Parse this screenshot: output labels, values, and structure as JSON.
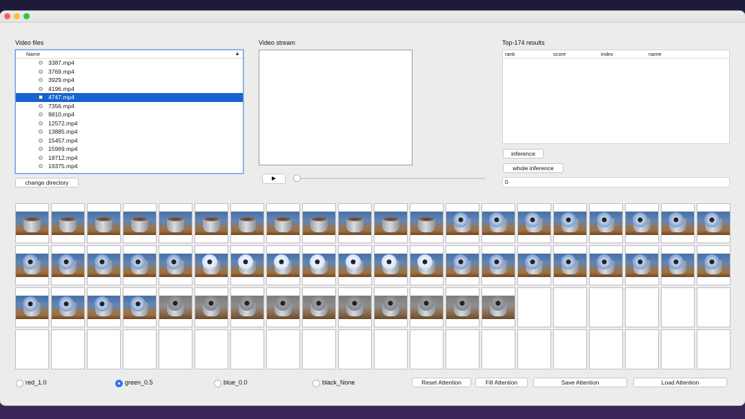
{
  "window": {
    "controls": [
      "close",
      "minimize",
      "zoom"
    ]
  },
  "files": {
    "title": "Video files",
    "column_header": "Name",
    "sort_indicator": "▲",
    "items": [
      "3387.mp4",
      "3769.mp4",
      "3929.mp4",
      "4196.mp4",
      "4747.mp4",
      "7356.mp4",
      "9810.mp4",
      "12572.mp4",
      "13885.mp4",
      "15457.mp4",
      "15969.mp4",
      "18712.mp4",
      "19375.mp4"
    ],
    "selected": "4747.mp4",
    "change_directory": "change directory"
  },
  "video": {
    "title": "Video stream",
    "play_icon": "play-icon",
    "progress": 0
  },
  "results": {
    "title": "Top-174 results",
    "columns": [
      "rank",
      "score",
      "index",
      "name"
    ],
    "inference_button": "inference",
    "whole_inference_button": "whole inference",
    "value": "0"
  },
  "thumbnails": {
    "rows": 4,
    "cols": 20,
    "filled_count": 54
  },
  "attention": {
    "radios": [
      {
        "label": "red_1.0",
        "checked": false
      },
      {
        "label": "green_0.5",
        "checked": true
      },
      {
        "label": "blue_0.0",
        "checked": false
      },
      {
        "label": "black_None",
        "checked": false
      }
    ],
    "reset": "Reset Attention",
    "fill": "Fill Attention",
    "save": "Save Attention",
    "load": "Load Attention"
  },
  "colors": {
    "selection": "#1862d4",
    "radio_on": "#2b7ae6"
  }
}
